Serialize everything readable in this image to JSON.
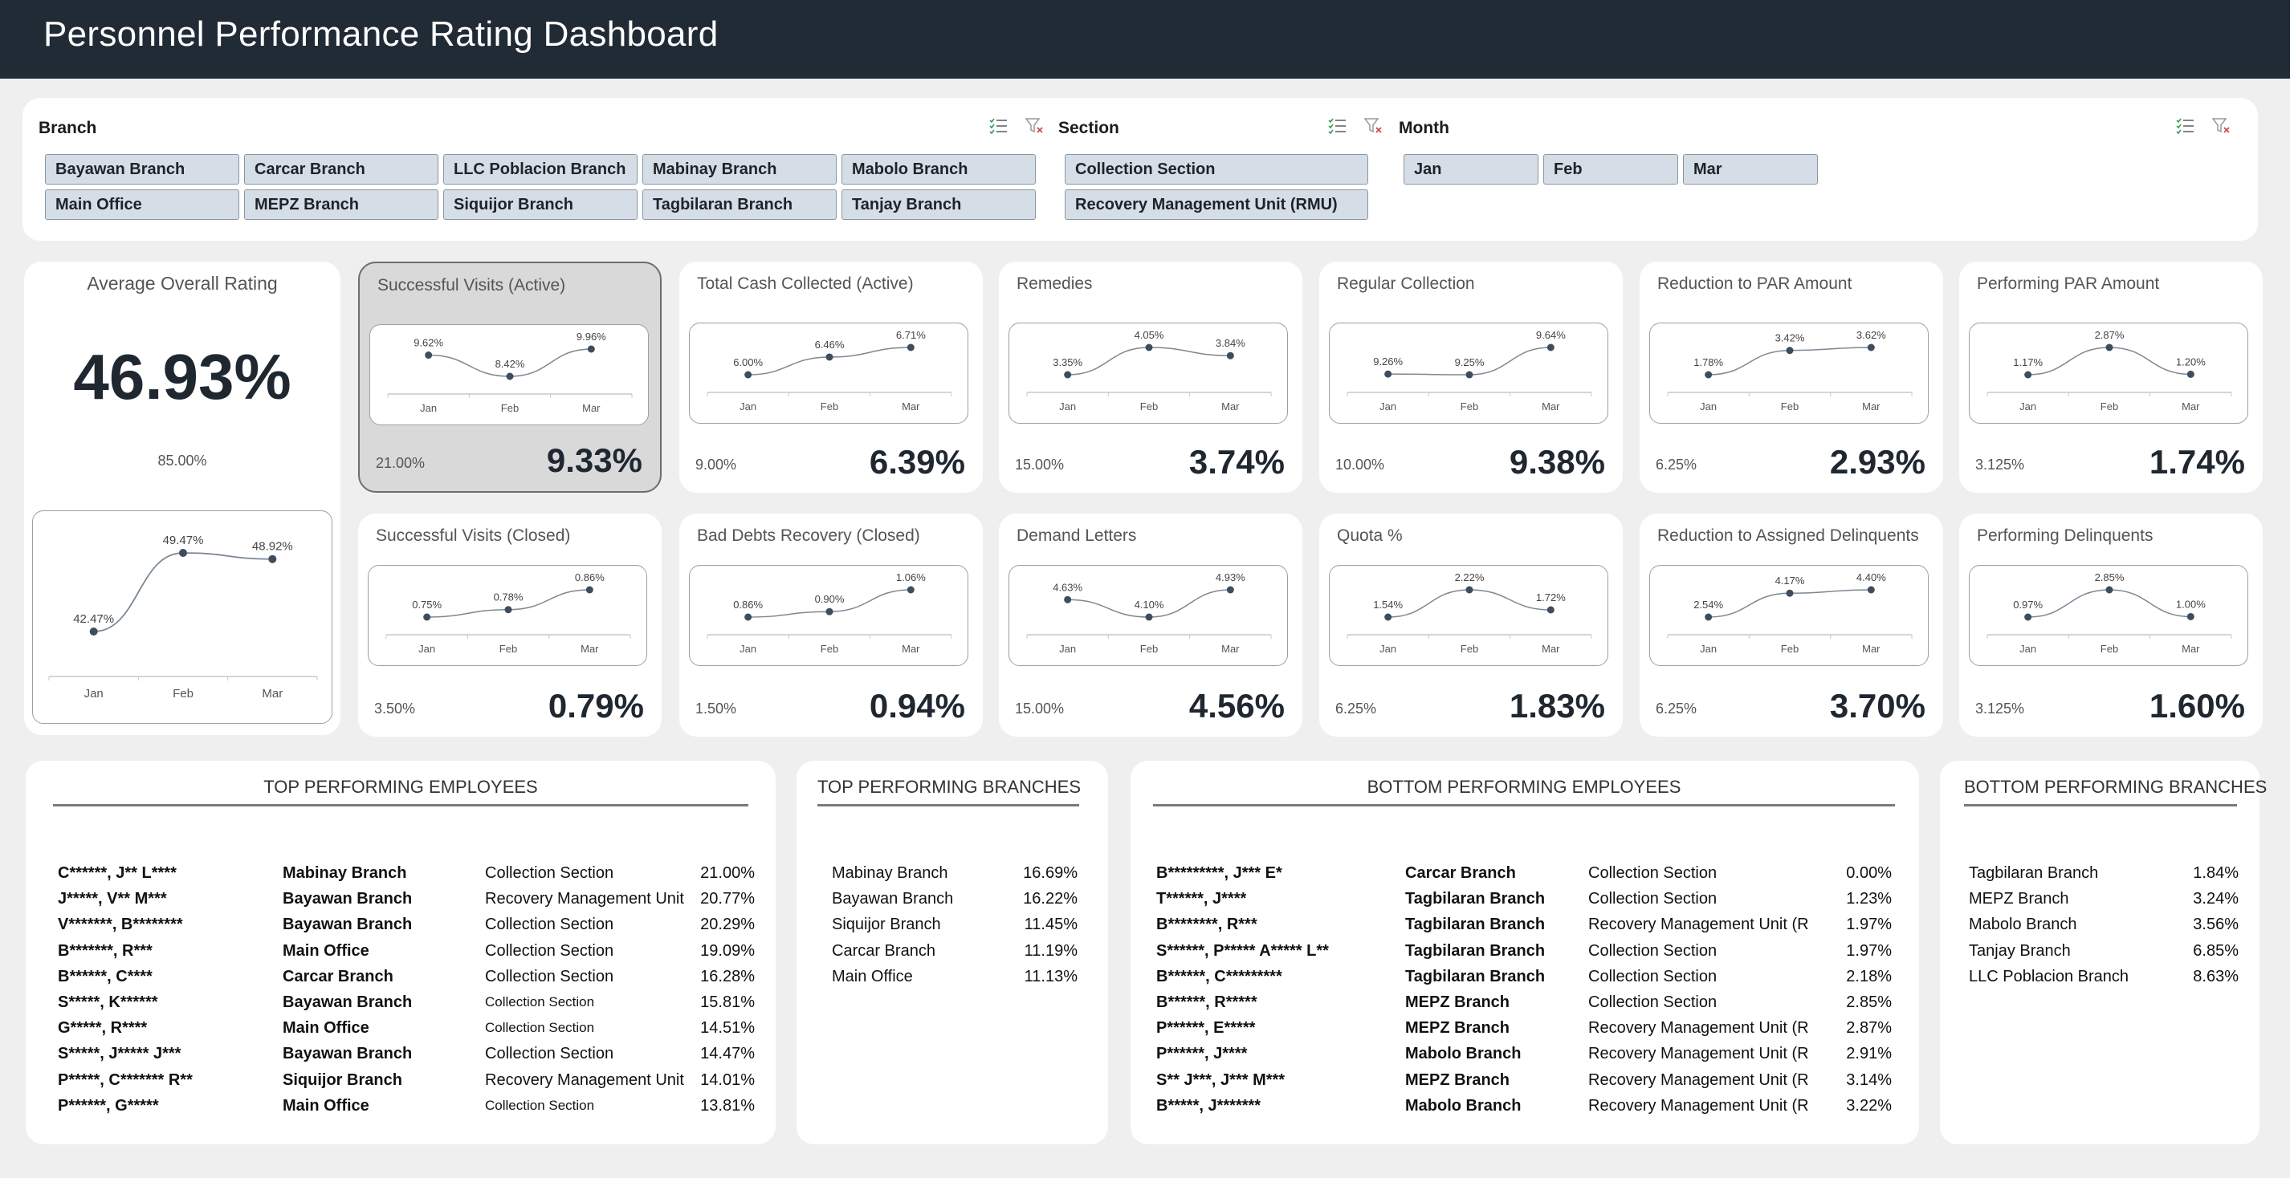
{
  "header": {
    "title": "Personnel Performance Rating Dashboard"
  },
  "slicers": {
    "branch": {
      "title": "Branch",
      "options": [
        "Bayawan Branch",
        "Carcar Branch",
        "LLC Poblacion Branch",
        "Mabinay Branch",
        "Mabolo Branch",
        "Main Office",
        "MEPZ Branch",
        "Siquijor Branch",
        "Tagbilaran Branch",
        "Tanjay Branch"
      ]
    },
    "section": {
      "title": "Section",
      "options": [
        "Collection Section",
        "Recovery Management Unit (RMU)"
      ]
    },
    "month": {
      "title": "Month",
      "options": [
        "Jan",
        "Feb",
        "Mar"
      ]
    }
  },
  "icons": {
    "multi_select": "multi-select-icon",
    "clear_filter": "clear-filter-icon"
  },
  "colors": {
    "header_bg": "#212b35",
    "slicer_button": "#d5dde7",
    "line": "#7b8894",
    "point": "#3e4d5e"
  },
  "months": [
    "Jan",
    "Feb",
    "Mar"
  ],
  "average": {
    "title": "Average Overall Rating",
    "value": "46.93%",
    "target": "85.00%",
    "points": [
      42.47,
      49.47,
      48.92
    ],
    "labels": [
      "42.47%",
      "49.47%",
      "48.92%"
    ]
  },
  "kpis": [
    {
      "title": "Successful Visits (Active)",
      "target": "21.00%",
      "value": "9.33%",
      "points": [
        9.62,
        8.42,
        9.96
      ],
      "labels": [
        "9.62%",
        "8.42%",
        "9.96%"
      ],
      "selected": true
    },
    {
      "title": "Total Cash Collected (Active)",
      "target": "9.00%",
      "value": "6.39%",
      "points": [
        6.0,
        6.46,
        6.71
      ],
      "labels": [
        "6.00%",
        "6.46%",
        "6.71%"
      ]
    },
    {
      "title": "Remedies",
      "target": "15.00%",
      "value": "3.74%",
      "points": [
        3.35,
        4.05,
        3.84
      ],
      "labels": [
        "3.35%",
        "4.05%",
        "3.84%"
      ]
    },
    {
      "title": "Regular Collection",
      "target": "10.00%",
      "value": "9.38%",
      "points": [
        9.26,
        9.25,
        9.64
      ],
      "labels": [
        "9.26%",
        "9.25%",
        "9.64%"
      ]
    },
    {
      "title": "Reduction to PAR Amount",
      "target": "6.25%",
      "value": "2.93%",
      "points": [
        1.78,
        3.42,
        3.62
      ],
      "labels": [
        "1.78%",
        "3.42%",
        "3.62%"
      ]
    },
    {
      "title": "Performing PAR Amount",
      "target": "3.125%",
      "value": "1.74%",
      "points": [
        1.17,
        2.87,
        1.2
      ],
      "labels": [
        "1.17%",
        "2.87%",
        "1.20%"
      ]
    },
    {
      "title": "Successful Visits (Closed)",
      "target": "3.50%",
      "value": "0.79%",
      "points": [
        0.75,
        0.78,
        0.86
      ],
      "labels": [
        "0.75%",
        "0.78%",
        "0.86%"
      ]
    },
    {
      "title": "Bad Debts Recovery (Closed)",
      "target": "1.50%",
      "value": "0.94%",
      "points": [
        0.86,
        0.9,
        1.06
      ],
      "labels": [
        "0.86%",
        "0.90%",
        "1.06%"
      ]
    },
    {
      "title": "Demand Letters",
      "target": "15.00%",
      "value": "4.56%",
      "points": [
        4.63,
        4.1,
        4.93
      ],
      "labels": [
        "4.63%",
        "4.10%",
        "4.93%"
      ]
    },
    {
      "title": "Quota %",
      "target": "6.25%",
      "value": "1.83%",
      "points": [
        1.54,
        2.22,
        1.72
      ],
      "labels": [
        "1.54%",
        "2.22%",
        "1.72%"
      ]
    },
    {
      "title": "Reduction to Assigned Delinquents",
      "target": "6.25%",
      "value": "3.70%",
      "points": [
        2.54,
        4.17,
        4.4
      ],
      "labels": [
        "2.54%",
        "4.17%",
        "4.40%"
      ]
    },
    {
      "title": "Performing Delinquents",
      "target": "3.125%",
      "value": "1.60%",
      "points": [
        0.97,
        2.85,
        1.0
      ],
      "labels": [
        "0.97%",
        "2.85%",
        "1.00%"
      ]
    }
  ],
  "top_employees": {
    "title": "TOP PERFORMING EMPLOYEES",
    "rows": [
      {
        "name": "C******, J** L****",
        "branch": "Mabinay Branch",
        "section": "Collection Section",
        "pct": "21.00%"
      },
      {
        "name": "J*****, V** M***",
        "branch": "Bayawan Branch",
        "section": "Recovery Management Unit",
        "pct": "20.77%"
      },
      {
        "name": "V*******, B********",
        "branch": "Bayawan Branch",
        "section": "Collection Section",
        "pct": "20.29%"
      },
      {
        "name": "B*******, R***",
        "branch": "Main Office",
        "section": "Collection Section",
        "pct": "19.09%"
      },
      {
        "name": "B******, C****",
        "branch": "Carcar Branch",
        "section": "Collection Section",
        "pct": "16.28%"
      },
      {
        "name": "S*****, K******",
        "branch": "Bayawan Branch",
        "section": "Collection Section",
        "pct": "15.81%",
        "small": true
      },
      {
        "name": "G*****, R****",
        "branch": "Main Office",
        "section": "Collection Section",
        "pct": "14.51%",
        "small": true
      },
      {
        "name": "S*****, J***** J***",
        "branch": "Bayawan Branch",
        "section": "Collection Section",
        "pct": "14.47%"
      },
      {
        "name": "P*****, C******* R**",
        "branch": "Siquijor Branch",
        "section": "Recovery Management Unit",
        "pct": "14.01%"
      },
      {
        "name": "P******, G*****",
        "branch": "Main Office",
        "section": "Collection Section",
        "pct": "13.81%",
        "small": true
      }
    ]
  },
  "top_branches": {
    "title": "TOP PERFORMING BRANCHES",
    "rows": [
      {
        "branch": "Mabinay Branch",
        "pct": "16.69%"
      },
      {
        "branch": "Bayawan Branch",
        "pct": "16.22%"
      },
      {
        "branch": "Siquijor Branch",
        "pct": "11.45%"
      },
      {
        "branch": "Carcar Branch",
        "pct": "11.19%"
      },
      {
        "branch": "Main Office",
        "pct": "11.13%"
      }
    ]
  },
  "bottom_employees": {
    "title": "BOTTOM PERFORMING EMPLOYEES",
    "rows": [
      {
        "name": "B*********, J*** E*",
        "branch": "Carcar Branch",
        "section": "Collection Section",
        "pct": "0.00%"
      },
      {
        "name": "T******, J****",
        "branch": "Tagbilaran Branch",
        "section": "Collection Section",
        "pct": "1.23%"
      },
      {
        "name": "B********, R***",
        "branch": "Tagbilaran Branch",
        "section": "Recovery Management Unit (R",
        "pct": "1.97%"
      },
      {
        "name": "S******, P***** A***** L**",
        "branch": "Tagbilaran Branch",
        "section": "Collection Section",
        "pct": "1.97%"
      },
      {
        "name": "B******, C*********",
        "branch": "Tagbilaran Branch",
        "section": "Collection Section",
        "pct": "2.18%"
      },
      {
        "name": "B******, R*****",
        "branch": "MEPZ Branch",
        "section": "Collection Section",
        "pct": "2.85%"
      },
      {
        "name": "P******, E*****",
        "branch": "MEPZ Branch",
        "section": "Recovery Management Unit (R",
        "pct": "2.87%"
      },
      {
        "name": "P******, J****",
        "branch": "Mabolo Branch",
        "section": "Recovery Management Unit (R",
        "pct": "2.91%"
      },
      {
        "name": "S** J***, J*** M***",
        "branch": "MEPZ Branch",
        "section": "Recovery Management Unit (R",
        "pct": "3.14%"
      },
      {
        "name": "B*****, J*******",
        "branch": "Mabolo Branch",
        "section": "Recovery Management Unit (R",
        "pct": "3.22%"
      }
    ]
  },
  "bottom_branches": {
    "title": "BOTTOM PERFORMING BRANCHES",
    "rows": [
      {
        "branch": "Tagbilaran Branch",
        "pct": "1.84%"
      },
      {
        "branch": "MEPZ Branch",
        "pct": "3.24%"
      },
      {
        "branch": "Mabolo Branch",
        "pct": "3.56%"
      },
      {
        "branch": "Tanjay Branch",
        "pct": "6.85%"
      },
      {
        "branch": "LLC Poblacion Branch",
        "pct": "8.63%"
      }
    ]
  }
}
